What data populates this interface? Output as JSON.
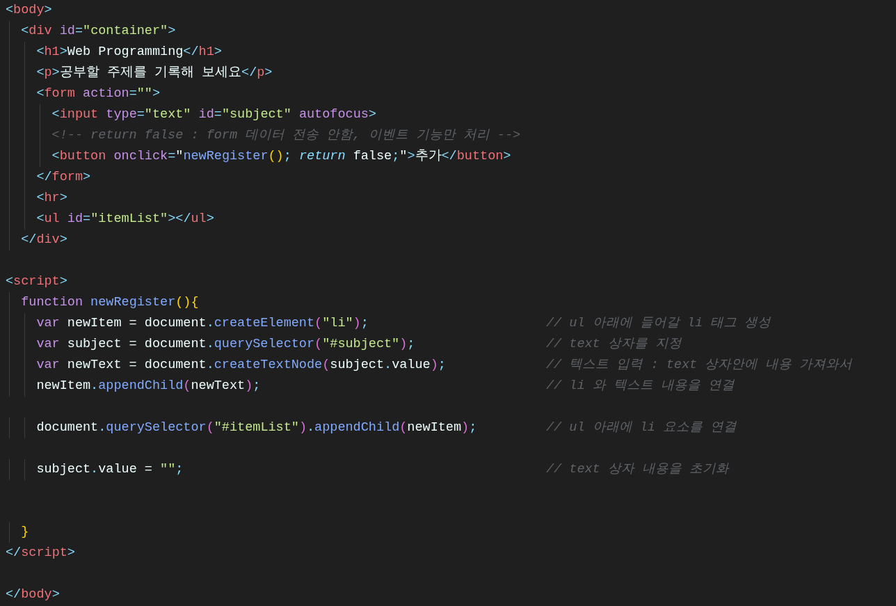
{
  "editor": {
    "lines": [
      {
        "kind": "code",
        "tokens": [
          {
            "kind": "br",
            "text": "<"
          },
          {
            "kind": "tag",
            "text": "body"
          },
          {
            "kind": "br",
            "text": ">"
          }
        ]
      },
      {
        "kind": "code",
        "tokens": [
          {
            "kind": "br",
            "text": "  <"
          },
          {
            "kind": "tag",
            "text": "div"
          },
          {
            "kind": "attr",
            "text": " id"
          },
          {
            "kind": "br",
            "text": "="
          },
          {
            "kind": "str",
            "text": "\"container\""
          },
          {
            "kind": "br",
            "text": ">"
          }
        ]
      },
      {
        "kind": "code",
        "tokens": [
          {
            "kind": "br",
            "text": "    <"
          },
          {
            "kind": "tag",
            "text": "h1"
          },
          {
            "kind": "br",
            "text": ">"
          },
          {
            "kind": "text",
            "text": "Web Programming"
          },
          {
            "kind": "br",
            "text": "</"
          },
          {
            "kind": "tag",
            "text": "h1"
          },
          {
            "kind": "br",
            "text": ">"
          }
        ]
      },
      {
        "kind": "code",
        "tokens": [
          {
            "kind": "br",
            "text": "    <"
          },
          {
            "kind": "tag",
            "text": "p"
          },
          {
            "kind": "br",
            "text": ">"
          },
          {
            "kind": "text",
            "text": "공부할 주제를 기록해 보세요"
          },
          {
            "kind": "br",
            "text": "</"
          },
          {
            "kind": "tag",
            "text": "p"
          },
          {
            "kind": "br",
            "text": ">"
          }
        ]
      },
      {
        "kind": "code",
        "tokens": [
          {
            "kind": "br",
            "text": "    <"
          },
          {
            "kind": "tag",
            "text": "form"
          },
          {
            "kind": "attr",
            "text": " action"
          },
          {
            "kind": "br",
            "text": "="
          },
          {
            "kind": "str",
            "text": "\"\""
          },
          {
            "kind": "br",
            "text": ">"
          }
        ]
      },
      {
        "kind": "code",
        "tokens": [
          {
            "kind": "br",
            "text": "      <"
          },
          {
            "kind": "tag",
            "text": "input"
          },
          {
            "kind": "attr",
            "text": " type"
          },
          {
            "kind": "br",
            "text": "="
          },
          {
            "kind": "str",
            "text": "\"text\""
          },
          {
            "kind": "attr",
            "text": " id"
          },
          {
            "kind": "br",
            "text": "="
          },
          {
            "kind": "str",
            "text": "\"subject\""
          },
          {
            "kind": "attr",
            "text": " autofocus"
          },
          {
            "kind": "br",
            "text": ">"
          }
        ]
      },
      {
        "kind": "code",
        "tokens": [
          {
            "kind": "comment",
            "text": "      <!-- return false : form 데이터 전송 안함, 이벤트 기능만 처리 -->"
          }
        ]
      },
      {
        "kind": "code",
        "tokens": [
          {
            "kind": "br",
            "text": "      <"
          },
          {
            "kind": "tag",
            "text": "button"
          },
          {
            "kind": "attr",
            "text": " onclick"
          },
          {
            "kind": "br",
            "text": "="
          },
          {
            "kind": "text",
            "text": "\""
          },
          {
            "kind": "fn",
            "text": "newRegister"
          },
          {
            "kind": "p1",
            "text": "()"
          },
          {
            "kind": "br",
            "text": ";"
          },
          {
            "kind": "ret",
            "text": " return"
          },
          {
            "kind": "text",
            "text": " false"
          },
          {
            "kind": "br",
            "text": ";"
          },
          {
            "kind": "text",
            "text": "\""
          },
          {
            "kind": "br",
            "text": ">"
          },
          {
            "kind": "text",
            "text": "추가"
          },
          {
            "kind": "br",
            "text": "</"
          },
          {
            "kind": "tag",
            "text": "button"
          },
          {
            "kind": "br",
            "text": ">"
          }
        ]
      },
      {
        "kind": "code",
        "tokens": [
          {
            "kind": "br",
            "text": "    </"
          },
          {
            "kind": "tag",
            "text": "form"
          },
          {
            "kind": "br",
            "text": ">"
          }
        ]
      },
      {
        "kind": "code",
        "tokens": [
          {
            "kind": "br",
            "text": "    <"
          },
          {
            "kind": "tag",
            "text": "hr"
          },
          {
            "kind": "br",
            "text": ">"
          }
        ]
      },
      {
        "kind": "code",
        "tokens": [
          {
            "kind": "br",
            "text": "    <"
          },
          {
            "kind": "tag",
            "text": "ul"
          },
          {
            "kind": "attr",
            "text": " id"
          },
          {
            "kind": "br",
            "text": "="
          },
          {
            "kind": "str",
            "text": "\"itemList\""
          },
          {
            "kind": "br",
            "text": "></"
          },
          {
            "kind": "tag",
            "text": "ul"
          },
          {
            "kind": "br",
            "text": ">"
          }
        ]
      },
      {
        "kind": "code",
        "tokens": [
          {
            "kind": "br",
            "text": "  </"
          },
          {
            "kind": "tag",
            "text": "div"
          },
          {
            "kind": "br",
            "text": ">"
          }
        ]
      },
      {
        "kind": "blank"
      },
      {
        "kind": "code",
        "tokens": [
          {
            "kind": "br",
            "text": "<"
          },
          {
            "kind": "tag",
            "text": "script"
          },
          {
            "kind": "br",
            "text": ">"
          }
        ]
      },
      {
        "kind": "code",
        "tokens": [
          {
            "kind": "kw",
            "text": "  function"
          },
          {
            "kind": "fn",
            "text": " newRegister"
          },
          {
            "kind": "p1",
            "text": "(){"
          }
        ]
      },
      {
        "kind": "code",
        "tokens": [
          {
            "kind": "kw",
            "text": "    var"
          },
          {
            "kind": "text",
            "text": " newItem = document"
          },
          {
            "kind": "br",
            "text": "."
          },
          {
            "kind": "fn",
            "text": "createElement"
          },
          {
            "kind": "p2",
            "text": "("
          },
          {
            "kind": "str",
            "text": "\"li\""
          },
          {
            "kind": "p2",
            "text": ")"
          },
          {
            "kind": "br",
            "text": ";"
          }
        ],
        "comment": "// ul 아래에 들어갈 li 태그 생성"
      },
      {
        "kind": "code",
        "tokens": [
          {
            "kind": "kw",
            "text": "    var"
          },
          {
            "kind": "text",
            "text": " subject = document"
          },
          {
            "kind": "br",
            "text": "."
          },
          {
            "kind": "fn",
            "text": "querySelector"
          },
          {
            "kind": "p2",
            "text": "("
          },
          {
            "kind": "str",
            "text": "\"#subject\""
          },
          {
            "kind": "p2",
            "text": ")"
          },
          {
            "kind": "br",
            "text": ";"
          }
        ],
        "comment": "// text 상자를 지정"
      },
      {
        "kind": "code",
        "tokens": [
          {
            "kind": "kw",
            "text": "    var"
          },
          {
            "kind": "text",
            "text": " newText = document"
          },
          {
            "kind": "br",
            "text": "."
          },
          {
            "kind": "fn",
            "text": "createTextNode"
          },
          {
            "kind": "p2",
            "text": "("
          },
          {
            "kind": "text",
            "text": "subject"
          },
          {
            "kind": "br",
            "text": "."
          },
          {
            "kind": "text",
            "text": "value"
          },
          {
            "kind": "p2",
            "text": ")"
          },
          {
            "kind": "br",
            "text": ";"
          }
        ],
        "comment": "// 텍스트 입력 : text 상자안에 내용 가져와서"
      },
      {
        "kind": "code",
        "tokens": [
          {
            "kind": "text",
            "text": "    newItem"
          },
          {
            "kind": "br",
            "text": "."
          },
          {
            "kind": "fn",
            "text": "appendChild"
          },
          {
            "kind": "p2",
            "text": "("
          },
          {
            "kind": "text",
            "text": "newText"
          },
          {
            "kind": "p2",
            "text": ")"
          },
          {
            "kind": "br",
            "text": ";"
          }
        ],
        "comment": "// li 와 텍스트 내용을 연결"
      },
      {
        "kind": "blank"
      },
      {
        "kind": "code",
        "tokens": [
          {
            "kind": "text",
            "text": "    document"
          },
          {
            "kind": "br",
            "text": "."
          },
          {
            "kind": "fn",
            "text": "querySelector"
          },
          {
            "kind": "p2",
            "text": "("
          },
          {
            "kind": "str",
            "text": "\"#itemList\""
          },
          {
            "kind": "p2",
            "text": ")"
          },
          {
            "kind": "br",
            "text": "."
          },
          {
            "kind": "fn",
            "text": "appendChild"
          },
          {
            "kind": "p2",
            "text": "("
          },
          {
            "kind": "text",
            "text": "newItem"
          },
          {
            "kind": "p2",
            "text": ")"
          },
          {
            "kind": "br",
            "text": ";"
          }
        ],
        "comment": "// ul 아래에 li 요소를 연결"
      },
      {
        "kind": "blank"
      },
      {
        "kind": "code",
        "tokens": [
          {
            "kind": "text",
            "text": "    subject"
          },
          {
            "kind": "br",
            "text": "."
          },
          {
            "kind": "text",
            "text": "value = "
          },
          {
            "kind": "str",
            "text": "\"\""
          },
          {
            "kind": "br",
            "text": ";"
          }
        ],
        "comment": "// text 상자 내용을 초기화"
      },
      {
        "kind": "blank"
      },
      {
        "kind": "blank"
      },
      {
        "kind": "code",
        "tokens": [
          {
            "kind": "p1",
            "text": "  }"
          }
        ]
      },
      {
        "kind": "code",
        "tokens": [
          {
            "kind": "br",
            "text": "</"
          },
          {
            "kind": "tag",
            "text": "script"
          },
          {
            "kind": "br",
            "text": ">"
          }
        ]
      },
      {
        "kind": "blank"
      },
      {
        "kind": "code",
        "tokens": [
          {
            "kind": "br",
            "text": "</"
          },
          {
            "kind": "tag",
            "text": "body"
          },
          {
            "kind": "br",
            "text": ">"
          }
        ]
      }
    ]
  }
}
